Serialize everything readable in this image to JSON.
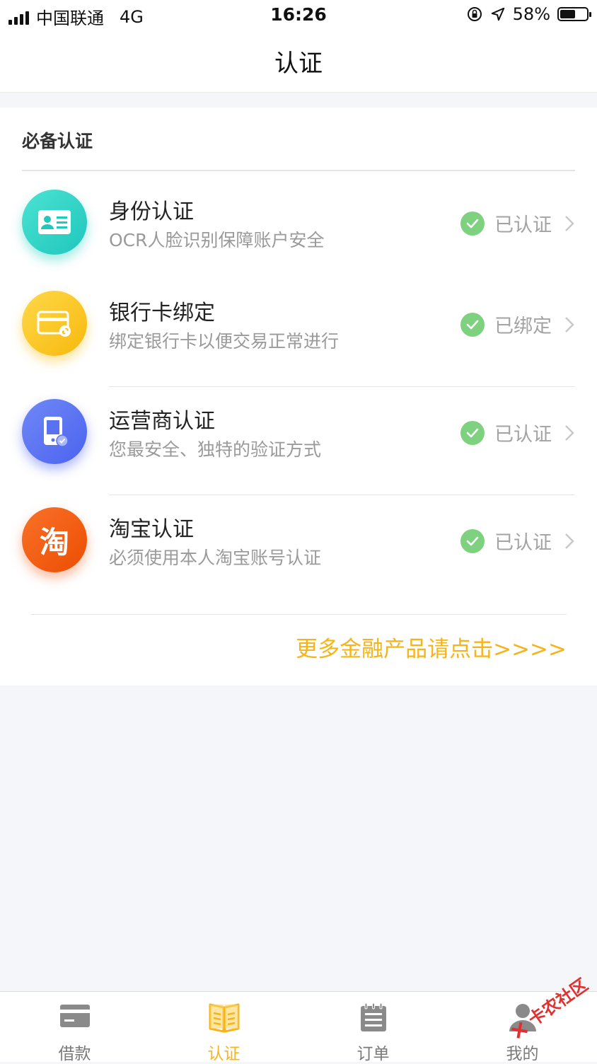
{
  "status_bar": {
    "carrier": "中国联通",
    "network": "4G",
    "time": "16:26",
    "battery": "58%",
    "battery_level": 0.58
  },
  "nav": {
    "title": "认证"
  },
  "section": {
    "title": "必备认证"
  },
  "items": [
    {
      "title": "身份认证",
      "subtitle": "OCR人脸识别保障账户安全",
      "status": "已认证",
      "icon": "id-card-icon",
      "color": "#2fd4c4"
    },
    {
      "title": "银行卡绑定",
      "subtitle": "绑定银行卡以便交易正常进行",
      "status": "已绑定",
      "icon": "bank-card-icon",
      "color": "#f9c21a"
    },
    {
      "title": "运营商认证",
      "subtitle": "您最安全、独特的验证方式",
      "status": "已认证",
      "icon": "phone-icon",
      "color": "#5a73f2"
    },
    {
      "title": "淘宝认证",
      "subtitle": "必须使用本人淘宝账号认证",
      "status": "已认证",
      "icon": "taobao-icon",
      "icon_text": "淘",
      "color": "#f25a0f"
    }
  ],
  "more_link": "更多金融产品请点击>>>>",
  "tabs": [
    {
      "label": "借款",
      "icon": "card-icon",
      "active": false
    },
    {
      "label": "认证",
      "icon": "book-icon",
      "active": true
    },
    {
      "label": "订单",
      "icon": "notepad-icon",
      "active": false
    },
    {
      "label": "我的",
      "icon": "person-icon",
      "active": false
    }
  ],
  "watermark": "卡农社区",
  "colors": {
    "accent": "#f6b41a",
    "check": "#7ed17e"
  }
}
